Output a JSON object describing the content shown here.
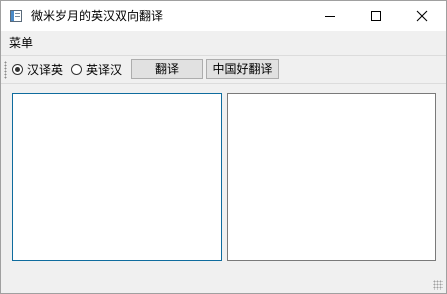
{
  "window": {
    "title": "微米岁月的英汉双向翻译",
    "icons": {
      "app": "app-window-icon",
      "minimize": "minimize-icon",
      "maximize": "maximize-icon",
      "close": "close-icon"
    }
  },
  "menubar": {
    "items": [
      {
        "label": "菜单"
      }
    ]
  },
  "toolbar": {
    "grip_icon": "toolbar-grip-icon",
    "radio_options": [
      {
        "label": "汉译英",
        "checked": true
      },
      {
        "label": "英译汉",
        "checked": false
      }
    ],
    "translate_button": "翻译",
    "cn_translate_button": "中国好翻译"
  },
  "editors": {
    "source_text": "",
    "target_text": ""
  },
  "colors": {
    "focus_border": "#0f6c9e",
    "window_bg": "#f0f0f0"
  }
}
